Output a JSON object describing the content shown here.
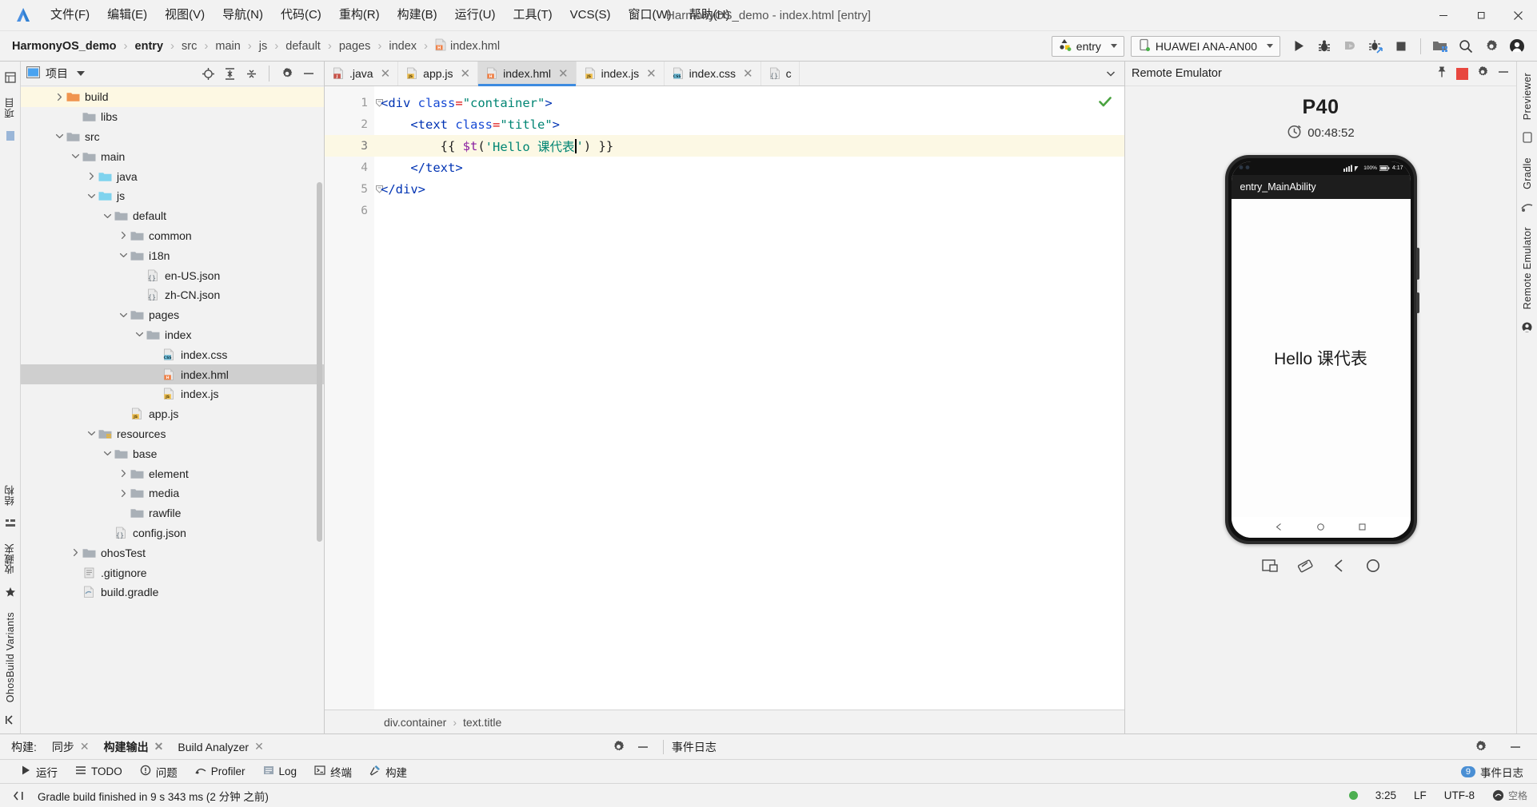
{
  "window": {
    "title": "HarmonyOS_demo - index.html [entry]",
    "minimize_label": "minimize-icon",
    "maximize_label": "restore-icon",
    "close_label": "close-icon"
  },
  "menu": {
    "items": [
      {
        "label": "文件(F)"
      },
      {
        "label": "编辑(E)"
      },
      {
        "label": "视图(V)"
      },
      {
        "label": "导航(N)"
      },
      {
        "label": "代码(C)"
      },
      {
        "label": "重构(R)"
      },
      {
        "label": "构建(B)"
      },
      {
        "label": "运行(U)"
      },
      {
        "label": "工具(T)"
      },
      {
        "label": "VCS(S)"
      },
      {
        "label": "窗口(W)"
      },
      {
        "label": "帮助(H)"
      }
    ]
  },
  "navbar": {
    "breadcrumbs": [
      "HarmonyOS_demo",
      "entry",
      "src",
      "main",
      "js",
      "default",
      "pages",
      "index",
      "index.hml"
    ],
    "run_config": "entry",
    "device": "HUAWEI ANA-AN00",
    "actions": [
      "run-icon",
      "debug-icon",
      "attach-debugger-icon",
      "profile-icon",
      "stop-icon",
      "device-manager-icon",
      "search-icon",
      "settings-icon",
      "account-icon"
    ]
  },
  "left_strip": {
    "tabs": [
      "项目",
      "结构",
      "收藏夹",
      "OhosBuild Variants"
    ]
  },
  "right_strip": {
    "tabs": [
      "Previewer",
      "Gradle",
      "Remote Emulator"
    ]
  },
  "project": {
    "title": "项目",
    "toolbar": [
      "locate-icon",
      "expand-all-icon",
      "collapse-all-icon",
      "settings-icon",
      "hide-icon"
    ],
    "tree": [
      {
        "label": "build",
        "indent": 2,
        "arrow": "right",
        "icon": "folder-orange",
        "state": "highlight"
      },
      {
        "label": "libs",
        "indent": 3,
        "arrow": "none",
        "icon": "folder-gray"
      },
      {
        "label": "src",
        "indent": 2,
        "arrow": "down",
        "icon": "folder-gray"
      },
      {
        "label": "main",
        "indent": 3,
        "arrow": "down",
        "icon": "folder-gray"
      },
      {
        "label": "java",
        "indent": 4,
        "arrow": "right",
        "icon": "folder-blue"
      },
      {
        "label": "js",
        "indent": 4,
        "arrow": "down",
        "icon": "folder-blue"
      },
      {
        "label": "default",
        "indent": 5,
        "arrow": "down",
        "icon": "folder-gray"
      },
      {
        "label": "common",
        "indent": 6,
        "arrow": "right",
        "icon": "folder-gray"
      },
      {
        "label": "i18n",
        "indent": 6,
        "arrow": "down",
        "icon": "folder-gray"
      },
      {
        "label": "en-US.json",
        "indent": 7,
        "arrow": "none",
        "icon": "file-json"
      },
      {
        "label": "zh-CN.json",
        "indent": 7,
        "arrow": "none",
        "icon": "file-json"
      },
      {
        "label": "pages",
        "indent": 6,
        "arrow": "down",
        "icon": "folder-gray"
      },
      {
        "label": "index",
        "indent": 7,
        "arrow": "down",
        "icon": "folder-gray"
      },
      {
        "label": "index.css",
        "indent": 8,
        "arrow": "none",
        "icon": "file-css"
      },
      {
        "label": "index.hml",
        "indent": 8,
        "arrow": "none",
        "icon": "file-hml",
        "state": "selected"
      },
      {
        "label": "index.js",
        "indent": 8,
        "arrow": "none",
        "icon": "file-js"
      },
      {
        "label": "app.js",
        "indent": 6,
        "arrow": "none",
        "icon": "file-js"
      },
      {
        "label": "resources",
        "indent": 4,
        "arrow": "down",
        "icon": "folder-res"
      },
      {
        "label": "base",
        "indent": 5,
        "arrow": "down",
        "icon": "folder-gray"
      },
      {
        "label": "element",
        "indent": 6,
        "arrow": "right",
        "icon": "folder-gray"
      },
      {
        "label": "media",
        "indent": 6,
        "arrow": "right",
        "icon": "folder-gray"
      },
      {
        "label": "rawfile",
        "indent": 6,
        "arrow": "none",
        "icon": "folder-gray"
      },
      {
        "label": "config.json",
        "indent": 5,
        "arrow": "none",
        "icon": "file-json"
      },
      {
        "label": "ohosTest",
        "indent": 3,
        "arrow": "right",
        "icon": "folder-gray"
      },
      {
        "label": ".gitignore",
        "indent": 3,
        "arrow": "none",
        "icon": "file-git"
      },
      {
        "label": "build.gradle",
        "indent": 3,
        "arrow": "none",
        "icon": "file-gradle"
      }
    ]
  },
  "editor": {
    "tabs": [
      {
        "label": ".java",
        "icon": "file-java",
        "active": false
      },
      {
        "label": "app.js",
        "icon": "file-js",
        "active": false
      },
      {
        "label": "index.hml",
        "icon": "file-hml",
        "active": true
      },
      {
        "label": "index.js",
        "icon": "file-js",
        "active": false
      },
      {
        "label": "index.css",
        "icon": "file-css",
        "active": false
      },
      {
        "label": "c",
        "icon": "file-json",
        "active": false
      }
    ],
    "line_numbers": [
      "1",
      "2",
      "3",
      "4",
      "5",
      "6"
    ],
    "code": [
      {
        "n": 1,
        "indent": 0,
        "current": false,
        "fold": true,
        "tokens": [
          {
            "t": "tag",
            "v": "<div "
          },
          {
            "t": "attr",
            "v": "class"
          },
          {
            "t": "eq",
            "v": "="
          },
          {
            "t": "str",
            "v": "\"container\""
          },
          {
            "t": "tag",
            "v": ">"
          }
        ]
      },
      {
        "n": 2,
        "indent": 1,
        "current": false,
        "fold": false,
        "tokens": [
          {
            "t": "tag",
            "v": "<text "
          },
          {
            "t": "attr",
            "v": "class"
          },
          {
            "t": "eq",
            "v": "="
          },
          {
            "t": "str",
            "v": "\"title\""
          },
          {
            "t": "tag",
            "v": ">"
          }
        ]
      },
      {
        "n": 3,
        "indent": 2,
        "current": true,
        "fold": false,
        "tokens": [
          {
            "t": "mus",
            "v": "{{ "
          },
          {
            "t": "fn",
            "v": "$t"
          },
          {
            "t": "punct",
            "v": "("
          },
          {
            "t": "str",
            "v": "'Hello 课代表'"
          },
          {
            "t": "punct",
            "v": ")"
          },
          {
            "t": "mus",
            "v": " }}"
          }
        ]
      },
      {
        "n": 4,
        "indent": 1,
        "current": false,
        "fold": false,
        "tokens": [
          {
            "t": "tag",
            "v": "</text>"
          }
        ]
      },
      {
        "n": 5,
        "indent": 0,
        "current": false,
        "fold": true,
        "tokens": [
          {
            "t": "tag",
            "v": "</div>"
          }
        ]
      },
      {
        "n": 6,
        "indent": 0,
        "current": false,
        "fold": false,
        "tokens": []
      }
    ],
    "inspection_status": "check-ok-icon",
    "bottom_breadcrumb": [
      "div.container",
      "text.title"
    ]
  },
  "emulator": {
    "title": "Remote Emulator",
    "header_actions": [
      "pin-icon",
      "stop-red-icon",
      "settings-icon",
      "hide-icon"
    ],
    "device_name": "P40",
    "timer": "00:48:52",
    "timer_icon": "clock-icon",
    "phone": {
      "status_time": "4:17",
      "battery": "100%",
      "app_bar_title": "entry_MainAbility",
      "screen_text": "Hello 课代表",
      "nav_buttons": [
        "back-triangle-icon",
        "home-circle-icon",
        "recents-square-icon"
      ]
    },
    "tools": [
      "screenshot-icon",
      "rotate-icon",
      "back-icon",
      "home-icon"
    ]
  },
  "build_panel": {
    "label": "构建:",
    "tabs": [
      {
        "label": "同步",
        "active": false
      },
      {
        "label": "构建输出",
        "active": true
      },
      {
        "label": "Build Analyzer",
        "active": false
      }
    ],
    "right_icons": [
      "settings-icon",
      "hide-icon"
    ],
    "event_log_label": "事件日志",
    "event_log_icons": [
      "settings-icon",
      "hide-icon"
    ]
  },
  "tool_window_bar": {
    "items": [
      {
        "label": "运行",
        "icon": "run-icon"
      },
      {
        "label": "TODO",
        "icon": "list-icon"
      },
      {
        "label": "问题",
        "icon": "warning-icon"
      },
      {
        "label": "Profiler",
        "icon": "profiler-icon"
      },
      {
        "label": "Log",
        "icon": "log-icon"
      },
      {
        "label": "终端",
        "icon": "terminal-icon"
      },
      {
        "label": "构建",
        "icon": "hammer-icon"
      }
    ],
    "event_log": {
      "label": "事件日志",
      "count": "9",
      "icon": "bell-icon"
    }
  },
  "status_bar": {
    "message": "Gradle build finished in 9 s 343 ms (2 分钟 之前)",
    "left_icon": "hide-icon",
    "indicator": "green-dot",
    "position": "3:25",
    "line_sep": "LF",
    "encoding": "UTF-8",
    "watermark": "空格"
  },
  "colors": {
    "accent": "#3d8be0",
    "selection": "#cfcfcf",
    "highlight_row": "#fdf8e3",
    "code_current_line": "#fcf8e4",
    "string_green": "#008573",
    "tag_blue": "#0033b3",
    "orange_folder": "#f0944e",
    "blue_folder": "#7fd3ee",
    "red_stop": "#e8473f",
    "green_ok": "#4caf50"
  }
}
